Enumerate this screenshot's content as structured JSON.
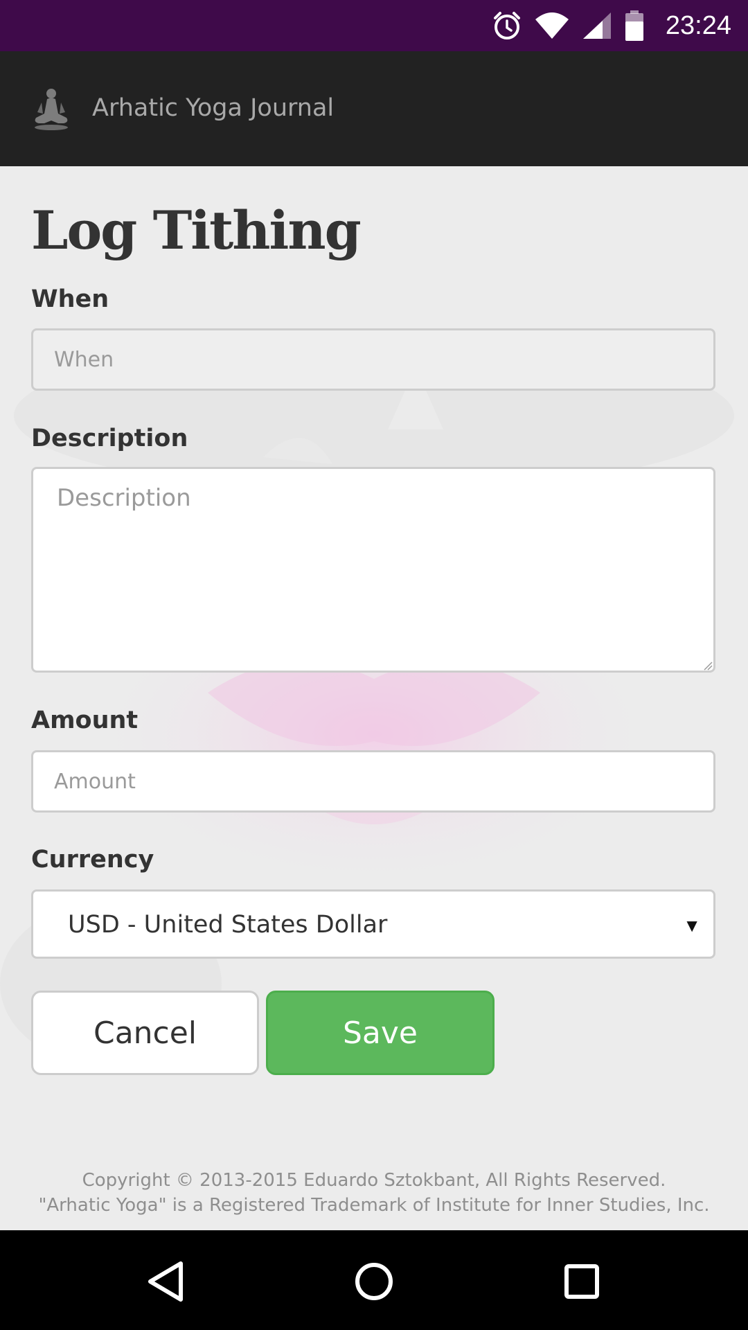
{
  "status_bar": {
    "time": "23:24",
    "icons": [
      "alarm-icon",
      "wifi-icon",
      "signal-icon",
      "battery-icon"
    ],
    "background": "#3f0a4a"
  },
  "app_bar": {
    "title": "Arhatic Yoga Journal",
    "logo_icon": "meditation-figure-icon",
    "background": "#222222"
  },
  "page": {
    "title": "Log Tithing"
  },
  "form": {
    "when": {
      "label": "When",
      "placeholder": "When",
      "value": ""
    },
    "description": {
      "label": "Description",
      "placeholder": "Description",
      "value": ""
    },
    "amount": {
      "label": "Amount",
      "placeholder": "Amount",
      "value": ""
    },
    "currency": {
      "label": "Currency",
      "selected": "USD - United States Dollar"
    }
  },
  "actions": {
    "cancel_label": "Cancel",
    "save_label": "Save",
    "save_color": "#5cb85c"
  },
  "footer": {
    "line1": "Copyright © 2013-2015 Eduardo Sztokbant, All Rights Reserved.",
    "line2": "\"Arhatic Yoga\" is a Registered Trademark of Institute for Inner Studies, Inc."
  },
  "nav_bar": {
    "buttons": [
      "back-icon",
      "home-icon",
      "recents-icon"
    ]
  }
}
